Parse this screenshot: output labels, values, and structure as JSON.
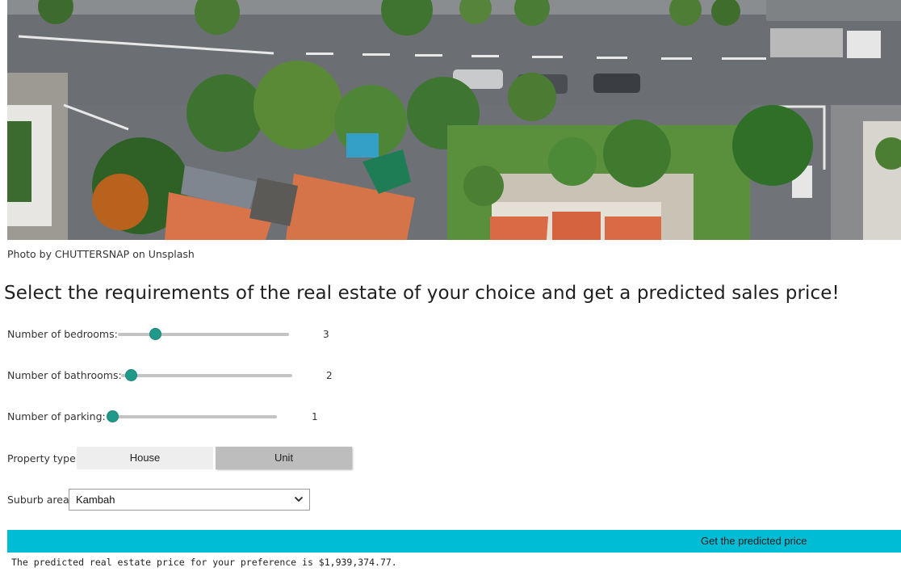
{
  "photo": {
    "alt": "Aerial view of street with houses and trees",
    "credit": "Photo by CHUTTERSNAP on Unsplash"
  },
  "heading": "Select the requirements of the real estate of your choice and get a predicted sales price!",
  "sliders": [
    {
      "label": "Number of bedrooms:",
      "value": "3",
      "level": 0.2
    },
    {
      "label": "Number of bathrooms:",
      "value": "2",
      "level": 0.05
    },
    {
      "label": "Number of parking:",
      "value": "1",
      "level": 0.0
    }
  ],
  "property_type": {
    "label": "Property type:",
    "options": [
      "House",
      "Unit"
    ],
    "selected": "Unit"
  },
  "suburb": {
    "label": "Suburb area:",
    "selected": "Kambah"
  },
  "predict_button": "Get the predicted price",
  "output": "The predicted real estate price for your preference is $1,939,374.77.",
  "colors": {
    "accent": "#00bcd4",
    "slider_thumb": "#21998a",
    "toggle_selected": "#bdbdbd",
    "toggle_unselected": "#eeeeee"
  }
}
